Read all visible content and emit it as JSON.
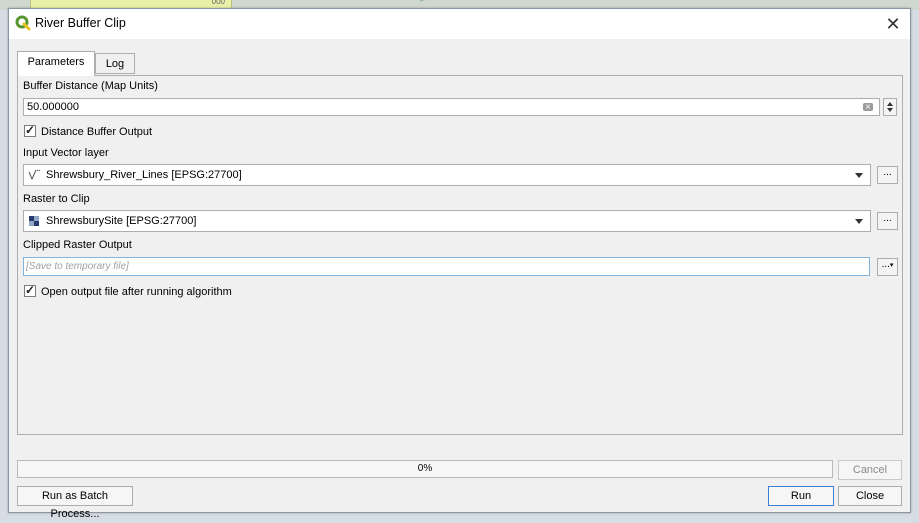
{
  "window": {
    "title": "River Buffer Clip"
  },
  "tabs": [
    {
      "label": "Parameters",
      "active": true
    },
    {
      "label": "Log",
      "active": false
    }
  ],
  "params": {
    "buffer_distance": {
      "label": "Buffer Distance (Map Units)",
      "value": "50.000000"
    },
    "distance_buffer_output": {
      "label": "Distance Buffer Output",
      "checked": true
    },
    "input_vector": {
      "label": "Input Vector layer",
      "value": "Shrewsbury_River_Lines [EPSG:27700]",
      "icon": "line-layer-icon",
      "browse_label": "..."
    },
    "raster_to_clip": {
      "label": "Raster to Clip",
      "value": "ShrewsburySite [EPSG:27700]",
      "icon": "raster-layer-icon",
      "browse_label": "..."
    },
    "clipped_output": {
      "label": "Clipped Raster Output",
      "placeholder": "[Save to temporary file]",
      "browse_label": "..."
    },
    "open_output": {
      "label": "Open output file after running algorithm",
      "checked": true
    }
  },
  "progress": {
    "text": "0%",
    "value": 0
  },
  "buttons": {
    "cancel": "Cancel",
    "batch": "Run as Batch Process...",
    "run": "Run",
    "close": "Close"
  },
  "background": {
    "tab_text": "000"
  },
  "colors": {
    "accent": "#3c7fd0",
    "qgis_green": "#589632"
  }
}
